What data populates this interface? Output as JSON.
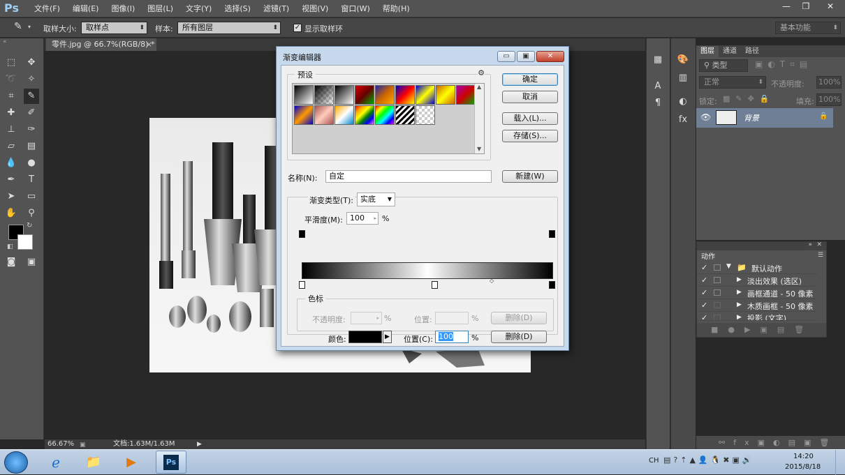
{
  "app": {
    "logo": "Ps",
    "menus": [
      "文件(F)",
      "编辑(E)",
      "图像(I)",
      "图层(L)",
      "文字(Y)",
      "选择(S)",
      "滤镜(T)",
      "视图(V)",
      "窗口(W)",
      "帮助(H)"
    ],
    "window_controls": {
      "minimize": "—",
      "restore": "❐",
      "close": "✕"
    }
  },
  "options_bar": {
    "sample_size_label": "取样大小:",
    "sample_size_value": "取样点",
    "sample_label": "样本:",
    "sample_value": "所有图层",
    "show_ring_label": "显示取样环",
    "show_ring_checked": true,
    "workspace": "基本功能"
  },
  "document": {
    "tab_title": "零件.jpg @ 66.7%(RGB/8) *",
    "tab_close": "×",
    "zoom": "66.67%",
    "doc_info": "文档:1.63M/1.63M"
  },
  "layers_panel": {
    "tabs": [
      "图层",
      "通道",
      "路径"
    ],
    "filter_kind": "类型",
    "blend_mode": "正常",
    "opacity_label": "不透明度:",
    "opacity_value": "100%",
    "lock_label": "锁定:",
    "fill_label": "填充:",
    "fill_value": "100%",
    "layer_name": "背景"
  },
  "actions_panel": {
    "title": "动作",
    "items": [
      {
        "label": "默认动作",
        "checked": true,
        "level": 0
      },
      {
        "label": "淡出效果 (选区)",
        "checked": true,
        "level": 1
      },
      {
        "label": "画框通道 - 50 像素",
        "checked": true,
        "level": 1
      },
      {
        "label": "木质画框 - 50 像素",
        "checked": true,
        "level": 1
      },
      {
        "label": "投影 (文字)",
        "checked": true,
        "level": 1
      }
    ]
  },
  "dialog": {
    "title": "渐变编辑器",
    "presets_label": "预设",
    "ok": "确定",
    "cancel": "取消",
    "load": "载入(L)...",
    "save": "存储(S)...",
    "name_label": "名称(N):",
    "name_value": "自定",
    "new_button": "新建(W)",
    "type_label": "渐变类型(T):",
    "type_value": "实底",
    "smooth_label": "平滑度(M):",
    "smooth_value": "100",
    "percent": "%",
    "stops_label": "色标",
    "opacity_label": "不透明度:",
    "opacity_pos_label": "位置:",
    "delete_top": "删除(D)",
    "color_label": "颜色:",
    "color_pos_label": "位置(C):",
    "color_pos_value": "100",
    "delete_bottom": "删除(D)"
  },
  "taskbar": {
    "lang": "CH",
    "time": "14:20",
    "date": "2015/8/18"
  }
}
